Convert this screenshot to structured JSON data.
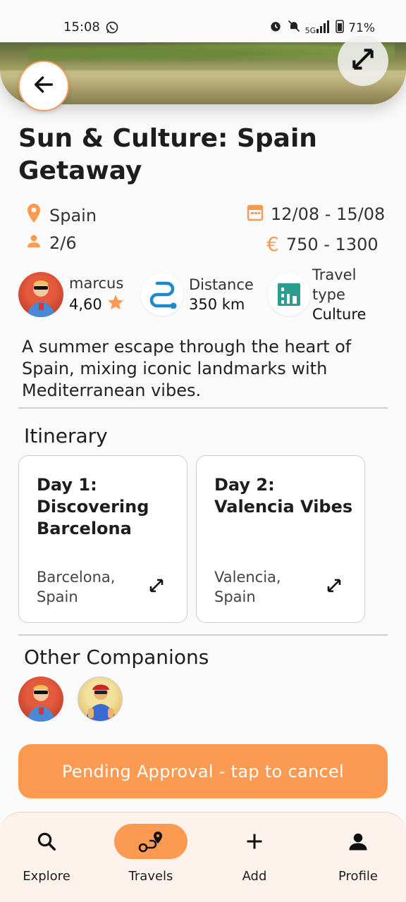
{
  "status_bar": {
    "time": "15:08",
    "battery": "71%",
    "network": "5G"
  },
  "trip": {
    "title": "Sun & Culture: Spain Getaway",
    "country": "Spain",
    "dates": "12/08 - 15/08",
    "participants": "2/6",
    "price": "750 - 1300",
    "currency_symbol": "€"
  },
  "organizer": {
    "name": "marcus",
    "rating": "4,60"
  },
  "distance": {
    "label": "Distance",
    "value": "350 km"
  },
  "travel_type": {
    "label_line1": "Travel",
    "label_line2": "type",
    "value": "Culture"
  },
  "description": "A summer escape through the heart of Spain, mixing iconic landmarks with Mediterranean vibes.",
  "itinerary": {
    "heading": "Itinerary",
    "days": [
      {
        "title": "Day 1: Discovering Barcelona",
        "location": "Barcelona, Spain"
      },
      {
        "title": "Day 2: Valencia Vibes",
        "location": "Valencia, Spain"
      }
    ]
  },
  "companions": {
    "heading": "Other Companions"
  },
  "cta": {
    "label": "Pending Approval - tap to cancel"
  },
  "nav": {
    "items": [
      {
        "label": "Explore",
        "icon": "search-icon"
      },
      {
        "label": "Travels",
        "icon": "route-icon"
      },
      {
        "label": "Add",
        "icon": "plus-icon"
      },
      {
        "label": "Profile",
        "icon": "person-icon"
      }
    ],
    "active": "Travels"
  },
  "colors": {
    "accent": "#fc9a52",
    "teal": "#2a9d8f",
    "blue": "#1e88c8"
  }
}
